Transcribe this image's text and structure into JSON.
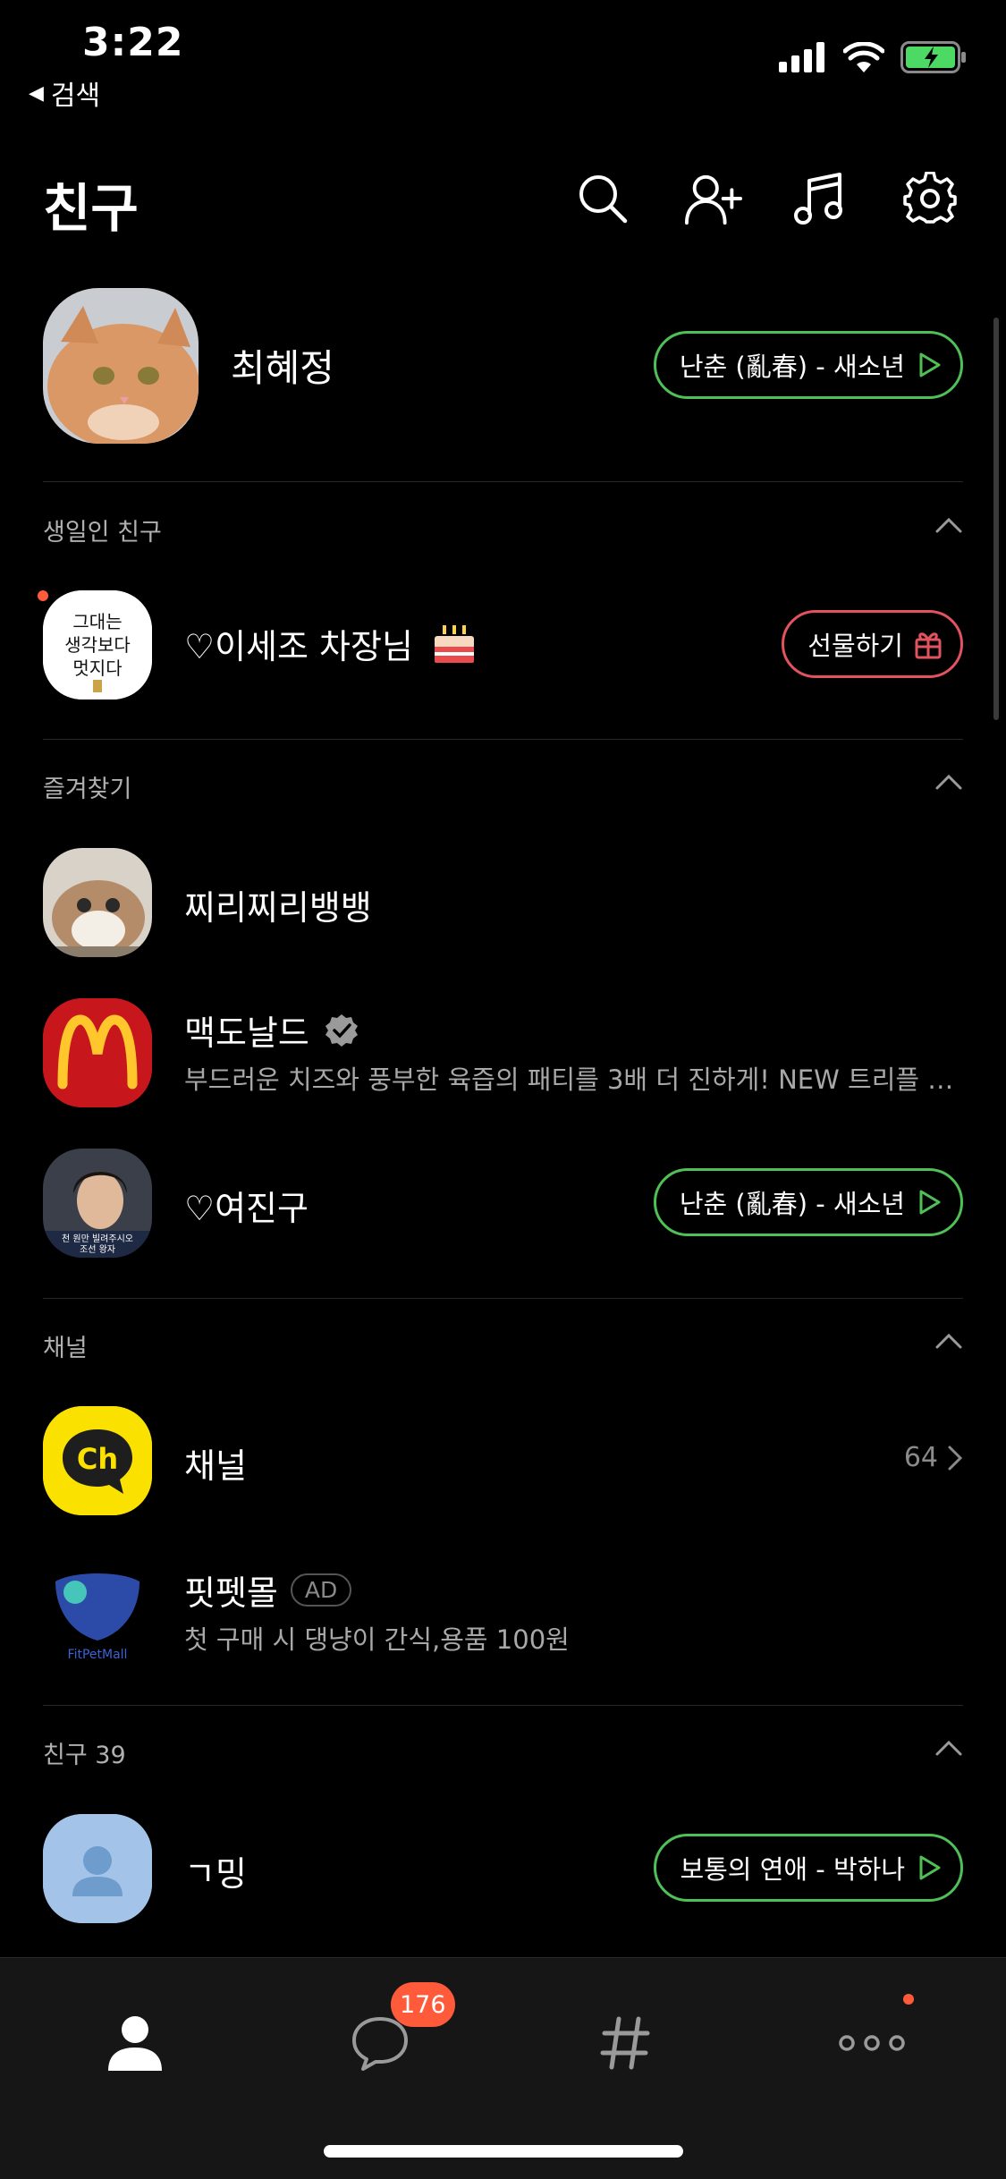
{
  "status_bar": {
    "time": "3:22",
    "back_label": "검색"
  },
  "header": {
    "title": "친구"
  },
  "profile": {
    "name": "최혜정",
    "music": "난춘 (亂春) - 새소년"
  },
  "sections": {
    "birthday": "생일인 친구",
    "favorites": "즐겨찾기",
    "channels": "채널",
    "friends": "친구 39"
  },
  "birthday_friend": {
    "name": "♡이세조 차장님",
    "gift_label": "선물하기",
    "avatar_text": "그대는 생각보다 멋지다"
  },
  "favorites": [
    {
      "name": "찌리찌리뱅뱅"
    },
    {
      "name": "맥도날드",
      "status": "부드러운 치즈와 풍부한 육즙의 패티를 3배 더 진하게! NEW 트리플 치..."
    },
    {
      "name": "♡여진구",
      "music": "난춘 (亂春) - 새소년",
      "avatar_caption": "천 원만 빌려주시오 조선 왕자"
    }
  ],
  "channels": {
    "channel": {
      "name": "채널",
      "count": "64",
      "logo": "Ch"
    },
    "ad": {
      "name": "핏펫몰",
      "badge": "AD",
      "status": "첫 구매 시 댕냥이 간식,용품 100원",
      "logo_text": "FitPetMall"
    }
  },
  "friends": [
    {
      "name": "ㄱ밍",
      "music": "보통의 연애 - 박하나"
    }
  ],
  "tabbar": {
    "chat_badge": "176"
  },
  "colors": {
    "music_border": "#4fbf57",
    "gift_border": "#e2535f",
    "badge": "#ff5a3a",
    "kakao_yellow": "#fae100"
  }
}
